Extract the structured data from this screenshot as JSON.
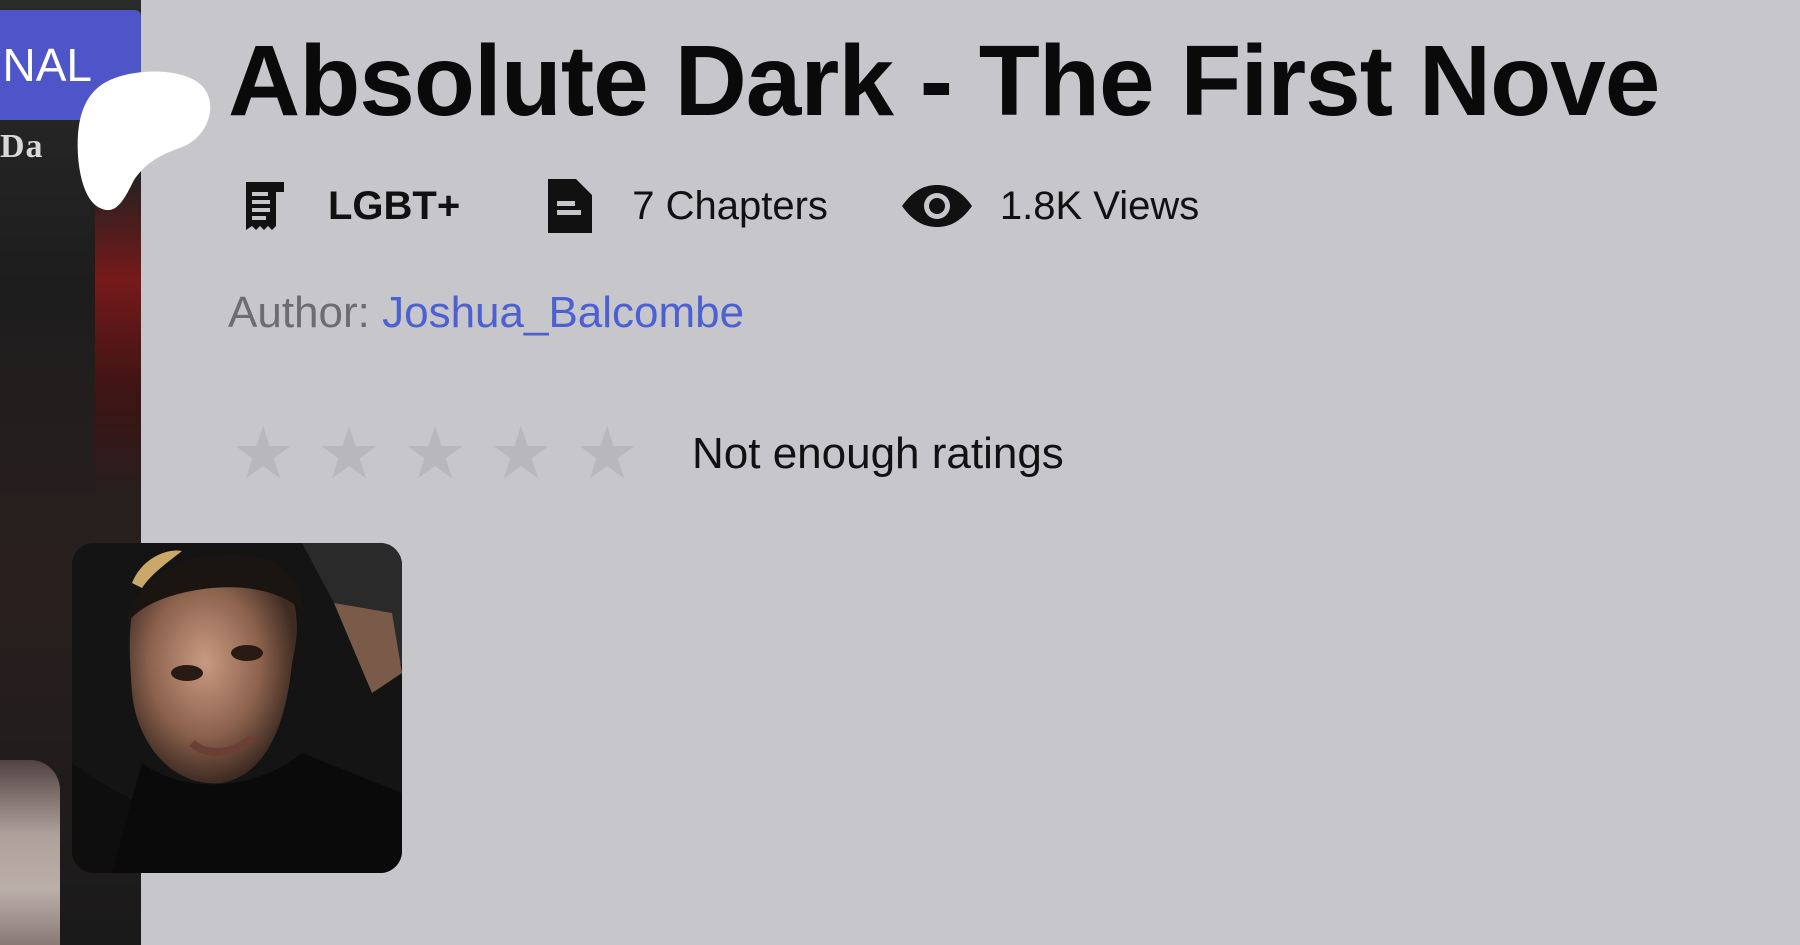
{
  "cover": {
    "badge_text": "NAL",
    "title_fragment": "Da"
  },
  "book": {
    "title": "Absolute Dark - The First Nove",
    "genre": "LGBT+",
    "chapters": "7 Chapters",
    "views": "1.8K Views"
  },
  "author": {
    "label": "Author: ",
    "name": "Joshua_Balcombe"
  },
  "rating": {
    "stars_total": 5,
    "stars_filled": 0,
    "text": "Not enough ratings"
  },
  "icons": {
    "genre": "receipt-icon",
    "chapters": "document-icon",
    "views": "eye-icon",
    "star": "star-icon"
  },
  "colors": {
    "background": "#c6c6cb",
    "badge": "#4e55c9",
    "author_link": "#4d60d2",
    "star_empty": "#b8b8bc"
  }
}
